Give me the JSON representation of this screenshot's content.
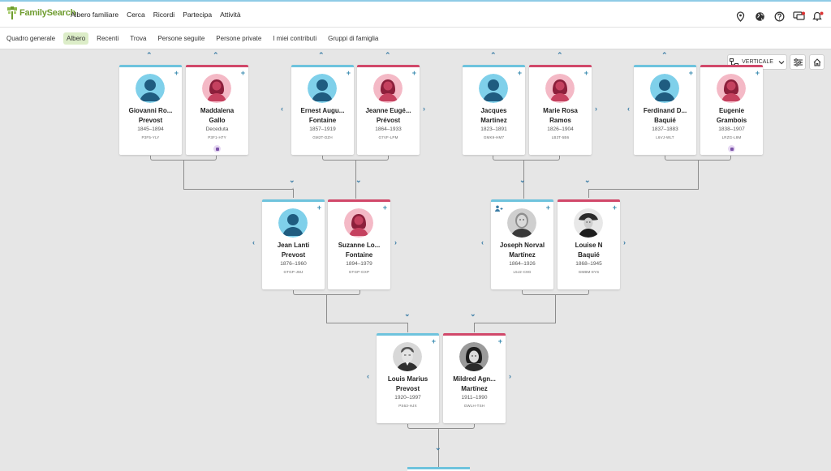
{
  "brand": {
    "name": "FamilySearch"
  },
  "topnav": [
    "Albero familiare",
    "Cerca",
    "Ricordi",
    "Partecipa",
    "Attività"
  ],
  "top_icons": [
    "location-pin-icon",
    "globe-icon",
    "help-icon",
    "messages-icon",
    "notifications-icon"
  ],
  "subnav": {
    "items": [
      "Quadro generale",
      "Albero",
      "Recenti",
      "Trova",
      "Persone seguite",
      "Persone private",
      "I miei contributi",
      "Gruppi di famiglia"
    ],
    "active": "Albero"
  },
  "controls": {
    "view_label": "VERTICALE"
  },
  "people": {
    "giovanni": {
      "name1": "Giovanni Ro...",
      "name2": "Prevost",
      "dates": "1845–1894",
      "id": "P3F5-YLY",
      "gender": "male"
    },
    "maddalena": {
      "name1": "Maddalena",
      "name2": "Gallo",
      "dates": "Deceduta",
      "id": "P3F1-H7Y",
      "gender": "female"
    },
    "ernest": {
      "name1": "Ernest Augu...",
      "name2": "Fontaine",
      "dates": "1857–1919",
      "id": "GM2T-DZH",
      "gender": "male"
    },
    "jeanne": {
      "name1": "Jeanne Eugé...",
      "name2": "Prévost",
      "dates": "1864–1933",
      "id": "G7VF-LPM",
      "gender": "female"
    },
    "jacques": {
      "name1": "Jacques",
      "name2": "Martinez",
      "dates": "1823–1891",
      "id": "GMK9-HM7",
      "gender": "male"
    },
    "marie": {
      "name1": "Marie Rosa",
      "name2": "Ramos",
      "dates": "1826–1904",
      "id": "LB3T-5B6",
      "gender": "female"
    },
    "ferdinand": {
      "name1": "Ferdinand D...",
      "name2": "Baquié",
      "dates": "1837–1883",
      "id": "L6VJ-WLT",
      "gender": "male"
    },
    "eugenie": {
      "name1": "Eugenie",
      "name2": "Grambois",
      "dates": "1838–1907",
      "id": "LRZG-L8M",
      "gender": "female"
    },
    "jean": {
      "name1": "Jean Lanti",
      "name2": "Prevost",
      "dates": "1876–1960",
      "id": "GTGP-JMJ",
      "gender": "male"
    },
    "suzanne": {
      "name1": "Suzanne Lo...",
      "name2": "Fontaine",
      "dates": "1894–1979",
      "id": "GTGP-GXP",
      "gender": "female"
    },
    "joseph": {
      "name1": "Joseph Norval",
      "name2": "Martínez",
      "dates": "1864–1926",
      "id": "L5J2-C9G",
      "gender": "male"
    },
    "louise": {
      "name1": "Louise N",
      "name2": "Baquié",
      "dates": "1868–1945",
      "id": "GMBM-8YS",
      "gender": "female"
    },
    "louis": {
      "name1": "Louis Marius",
      "name2": "Prevost",
      "dates": "1920–1997",
      "id": "PS63-HJX",
      "gender": "male"
    },
    "mildred": {
      "name1": "Mildred Agn...",
      "name2": "Martínez",
      "dates": "1911–1990",
      "id": "GWLH-TSH",
      "gender": "female"
    }
  },
  "colors": {
    "male": "#6ec3dd",
    "female": "#d1486a",
    "accent": "#3a7ca5",
    "active_tab": "#dcedc8"
  }
}
